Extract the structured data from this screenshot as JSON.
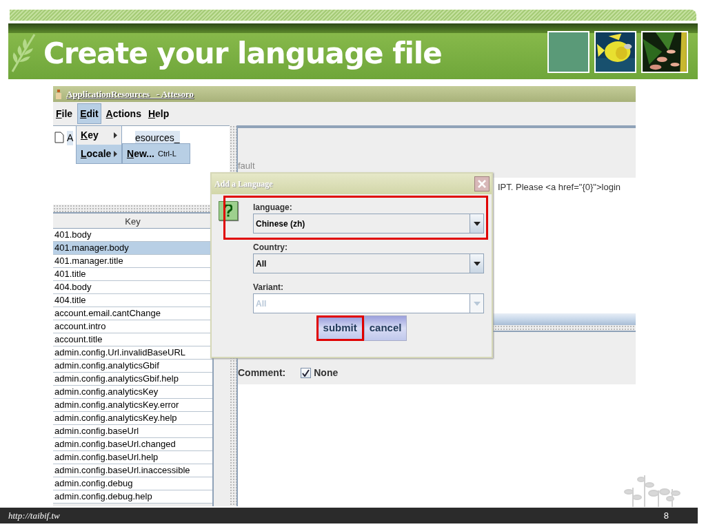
{
  "slide": {
    "title": "Create your language file",
    "footer_url": "http://taibif.tw",
    "page_number": "8"
  },
  "app": {
    "window_title": "ApplicationResources_ - Attesoro",
    "menu": [
      {
        "label": "File",
        "selected": false
      },
      {
        "label": "Edit",
        "selected": true
      },
      {
        "label": "Actions",
        "selected": false
      },
      {
        "label": "Help",
        "selected": false
      }
    ],
    "edit_menu": [
      {
        "label": "Key",
        "selected": false
      },
      {
        "label": "Locale",
        "selected": true
      }
    ],
    "locale_submenu": [
      {
        "label": "New...",
        "shortcut": "Ctrl-L",
        "selected": true
      }
    ],
    "tree_item": {
      "label_start": "A",
      "label_end": "esources_"
    },
    "key_table": {
      "columns": [
        "Key"
      ],
      "rows": [
        {
          "key": "401.body",
          "selected": false
        },
        {
          "key": "401.manager.body",
          "selected": true
        },
        {
          "key": "401.manager.title",
          "selected": false
        },
        {
          "key": "401.title",
          "selected": false
        },
        {
          "key": "404.body",
          "selected": false
        },
        {
          "key": "404.title",
          "selected": false
        },
        {
          "key": "account.email.cantChange",
          "selected": false
        },
        {
          "key": "account.intro",
          "selected": false
        },
        {
          "key": "account.title",
          "selected": false
        },
        {
          "key": "admin.config.Url.invalidBaseURL",
          "selected": false
        },
        {
          "key": "admin.config.analyticsGbif",
          "selected": false
        },
        {
          "key": "admin.config.analyticsGbif.help",
          "selected": false
        },
        {
          "key": "admin.config.analyticsKey",
          "selected": false
        },
        {
          "key": "admin.config.analyticsKey.error",
          "selected": false
        },
        {
          "key": "admin.config.analyticsKey.help",
          "selected": false
        },
        {
          "key": "admin.config.baseUrl",
          "selected": false
        },
        {
          "key": "admin.config.baseUrl.changed",
          "selected": false
        },
        {
          "key": "admin.config.baseUrl.help",
          "selected": false
        },
        {
          "key": "admin.config.baseUrl.inaccessible",
          "selected": false
        },
        {
          "key": "admin.config.debug",
          "selected": false
        },
        {
          "key": "admin.config.debug.help",
          "selected": false
        }
      ]
    },
    "editor": {
      "locale_label": "fault",
      "text_row": "IPT. Please <a href=\"{0}\">login",
      "comment_label": "Comment:",
      "comment_checkbox": {
        "label": "None",
        "checked": true
      }
    },
    "dialog": {
      "title": "Add a Language",
      "fields": [
        {
          "label": "language:",
          "value": "Chinese (zh)",
          "disabled": false,
          "highlighted": true
        },
        {
          "label": "Country:",
          "value": "All",
          "disabled": false,
          "highlighted": false
        },
        {
          "label": "Variant:",
          "value": "All",
          "disabled": true,
          "highlighted": false
        }
      ],
      "buttons": [
        {
          "label": "submit",
          "highlighted": true
        },
        {
          "label": "cancel",
          "highlighted": false
        }
      ]
    }
  }
}
